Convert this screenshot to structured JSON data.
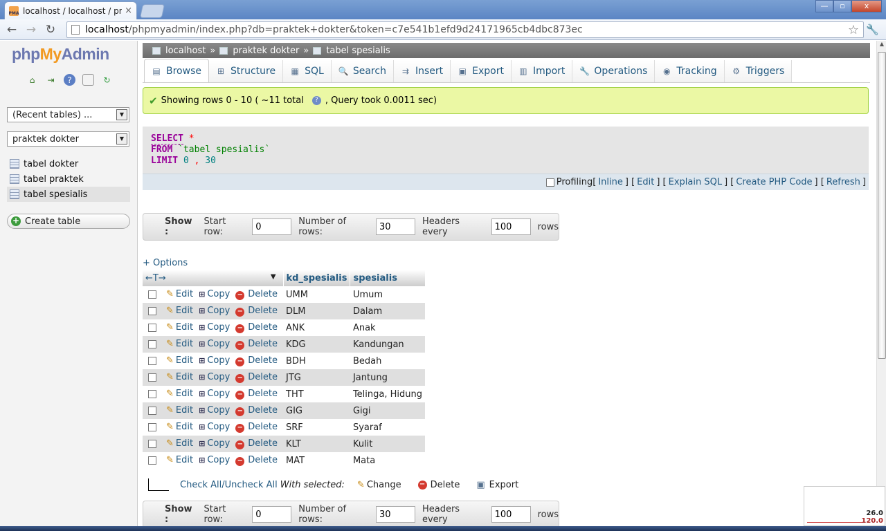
{
  "browser": {
    "tab_title": "localhost / localhost / prak",
    "tab_close": "×",
    "url_host": "localhost",
    "url_rest": "/phpmyadmin/index.php?db=praktek+dokter&token=c7e541b1efd9d24171965cb4dbc873ec",
    "back_icon": "←",
    "forward_icon": "→",
    "reload_icon": "↻",
    "star_icon": "☆",
    "wrench_icon": "🔧",
    "win_min": "—",
    "win_max": "▫",
    "win_close": "x"
  },
  "sidebar": {
    "logo_php": "php",
    "logo_my": "My",
    "logo_admin": "Admin",
    "recent_select": "(Recent tables) ...",
    "db_select": "praktek dokter",
    "tables": [
      {
        "label": "tabel dokter"
      },
      {
        "label": "tabel praktek"
      },
      {
        "label": "tabel spesialis"
      }
    ],
    "create_table": "Create table"
  },
  "breadcrumb": {
    "server": "localhost",
    "database": "praktek dokter",
    "table": "tabel spesialis",
    "sep": "»"
  },
  "tabs": [
    {
      "label": "Browse",
      "icon": "▤"
    },
    {
      "label": "Structure",
      "icon": "⊞"
    },
    {
      "label": "SQL",
      "icon": "▦"
    },
    {
      "label": "Search",
      "icon": "🔍"
    },
    {
      "label": "Insert",
      "icon": "⇉"
    },
    {
      "label": "Export",
      "icon": "▣"
    },
    {
      "label": "Import",
      "icon": "▥"
    },
    {
      "label": "Operations",
      "icon": "🔧"
    },
    {
      "label": "Tracking",
      "icon": "◉"
    },
    {
      "label": "Triggers",
      "icon": "⚙"
    }
  ],
  "message": {
    "check": "✔",
    "part1": "Showing rows 0 - 10 ( ~11 total",
    "help": "?",
    "part2": ", Query took 0.0011 sec)"
  },
  "sql": {
    "select": "SELECT",
    "star": "*",
    "from": "FROM",
    "table": "`tabel spesialis`",
    "limit": "LIMIT",
    "offset": "0",
    "comma": ",",
    "count": "30"
  },
  "sqlbar": {
    "profiling": "Profiling",
    "inline": "Inline",
    "edit": "Edit",
    "explain": "Explain SQL",
    "php": "Create PHP Code",
    "refresh": "Refresh"
  },
  "nav": {
    "show": "Show :",
    "start_label": "Start row:",
    "start_value": "0",
    "rows_label": "Number of rows:",
    "rows_value": "30",
    "headers_label": "Headers every",
    "headers_value": "100",
    "rows_suffix": "rows"
  },
  "options_link": "+ Options",
  "table": {
    "col_arrows": "←T→",
    "sort_icon": "▼",
    "columns": [
      "kd_spesialis",
      "spesialis"
    ],
    "action_edit": "Edit",
    "action_copy": "Copy",
    "action_delete": "Delete",
    "pencil_icon": "✎",
    "copy_icon": "⊞",
    "delete_icon": "−",
    "rows": [
      {
        "kd": "UMM",
        "sp": "Umum"
      },
      {
        "kd": "DLM",
        "sp": "Dalam"
      },
      {
        "kd": "ANK",
        "sp": "Anak"
      },
      {
        "kd": "KDG",
        "sp": "Kandungan"
      },
      {
        "kd": "BDH",
        "sp": "Bedah"
      },
      {
        "kd": "JTG",
        "sp": "Jantung"
      },
      {
        "kd": "THT",
        "sp": "Telinga, Hidung"
      },
      {
        "kd": "GIG",
        "sp": "Gigi"
      },
      {
        "kd": "SRF",
        "sp": "Syaraf"
      },
      {
        "kd": "KLT",
        "sp": "Kulit"
      },
      {
        "kd": "MAT",
        "sp": "Mata"
      }
    ]
  },
  "bottom": {
    "check_all": "Check All",
    "slash": " / ",
    "uncheck_all": "Uncheck All",
    "with_selected": "With selected:",
    "change": "Change",
    "delete": "Delete",
    "export": "Export"
  },
  "widget": {
    "v1": "26.0",
    "v2": "120.0"
  },
  "colors": {
    "link": "#235a81",
    "success_bg": "#ebf8a4",
    "sql_keyword": "#990099"
  }
}
